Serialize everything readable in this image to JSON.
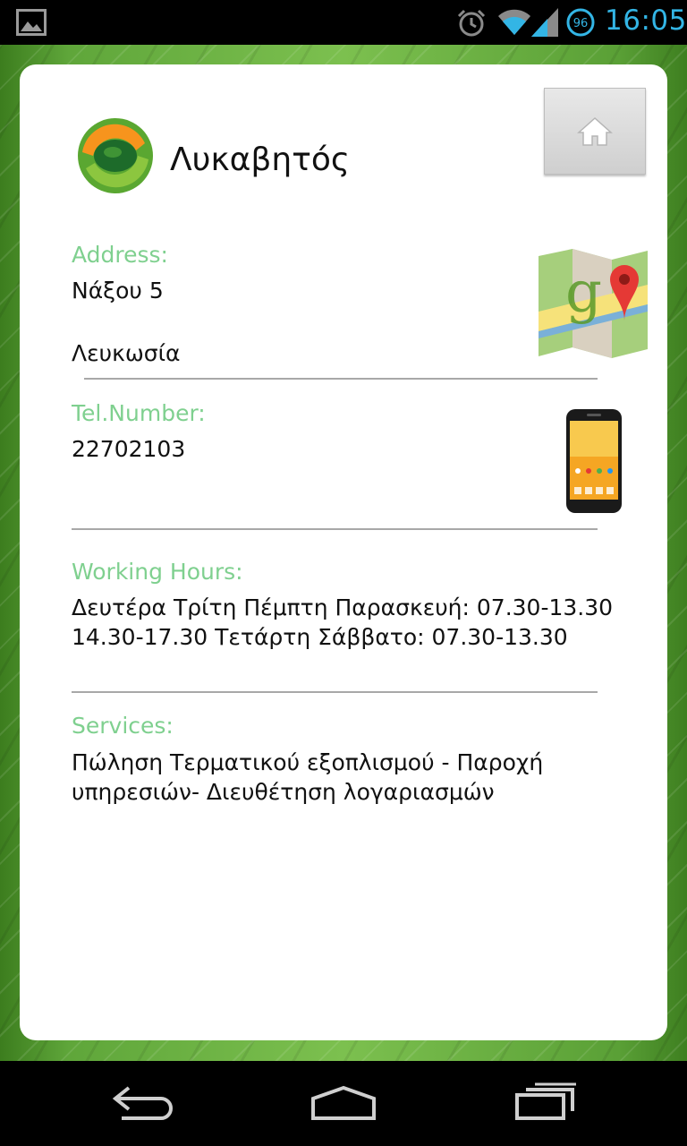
{
  "status_bar": {
    "time": "16:05",
    "battery_level": "96",
    "icons": [
      "gallery-icon",
      "alarm-icon",
      "wifi-icon",
      "signal-icon",
      "battery-icon"
    ],
    "time_color": "#33b5e5"
  },
  "store": {
    "name": "Λυκαβητός",
    "address_label": "Address:",
    "address_line1": "Νάξου 5",
    "address_line2": "Λευκωσία",
    "tel_label": "Tel.Number:",
    "tel_value": "22702103",
    "hours_label": "Working Hours:",
    "hours_line1": "Δευτέρα Τρίτη Πέμπτη Παρασκευή: 07.30-13.30",
    "hours_line2": "14.30-17.30 Τετάρτη Σάββατο: 07.30-13.30",
    "services_label": "Services:",
    "services_line1": "Πώληση Τερματικού εξοπλισμού - Παροχή",
    "services_line2": "υπηρεσιών- Διευθέτηση λογαριασμών"
  },
  "colors": {
    "label_green": "#7fd08f",
    "background_green": "#6ab443"
  },
  "icons": {
    "home": "home-icon",
    "maps": "google-maps-icon",
    "phone": "smartphone-icon",
    "logo": "brand-logo"
  },
  "nav_bar": {
    "buttons": [
      "back-icon",
      "home-nav-icon",
      "recents-icon"
    ]
  }
}
